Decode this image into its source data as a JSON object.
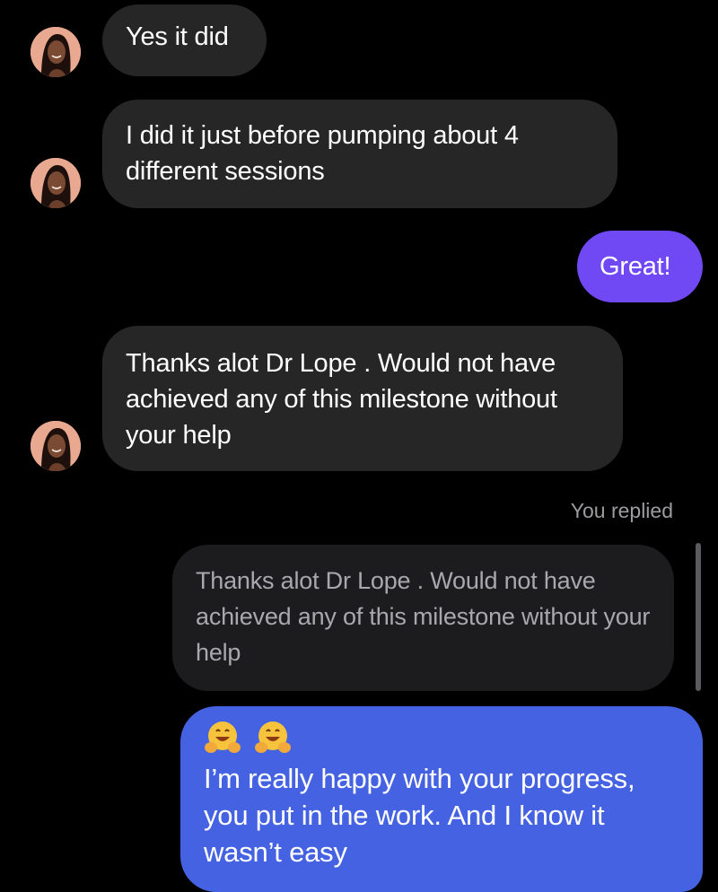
{
  "messages": [
    {
      "id": "m1",
      "direction": "incoming",
      "text": "Yes it did"
    },
    {
      "id": "m2",
      "direction": "incoming",
      "text": "I did it just before pumping about 4 different sessions"
    },
    {
      "id": "m3",
      "direction": "outgoing",
      "text": "Great!"
    },
    {
      "id": "m4",
      "direction": "incoming",
      "text": "Thanks alot Dr Lope . Would not have achieved any of this milestone without your help"
    },
    {
      "id": "m5",
      "direction": "outgoing",
      "reply_label": "You replied",
      "quoted_text": "Thanks alot Dr Lope . Would not have achieved any of this milestone without your help",
      "emoji": "hugging-face-emoji x2",
      "text": "I’m really happy with your progress, you put in the work. And I know it wasn’t easy"
    }
  ],
  "avatar_icon": "profile-photo",
  "colors": {
    "background": "#000000",
    "incoming_bubble": "#262626",
    "outgoing_purple": "#7049f5",
    "outgoing_blue": "#4462e1",
    "quoted_bubble": "#1c1c1e",
    "secondary_text": "#9c9ca0"
  }
}
